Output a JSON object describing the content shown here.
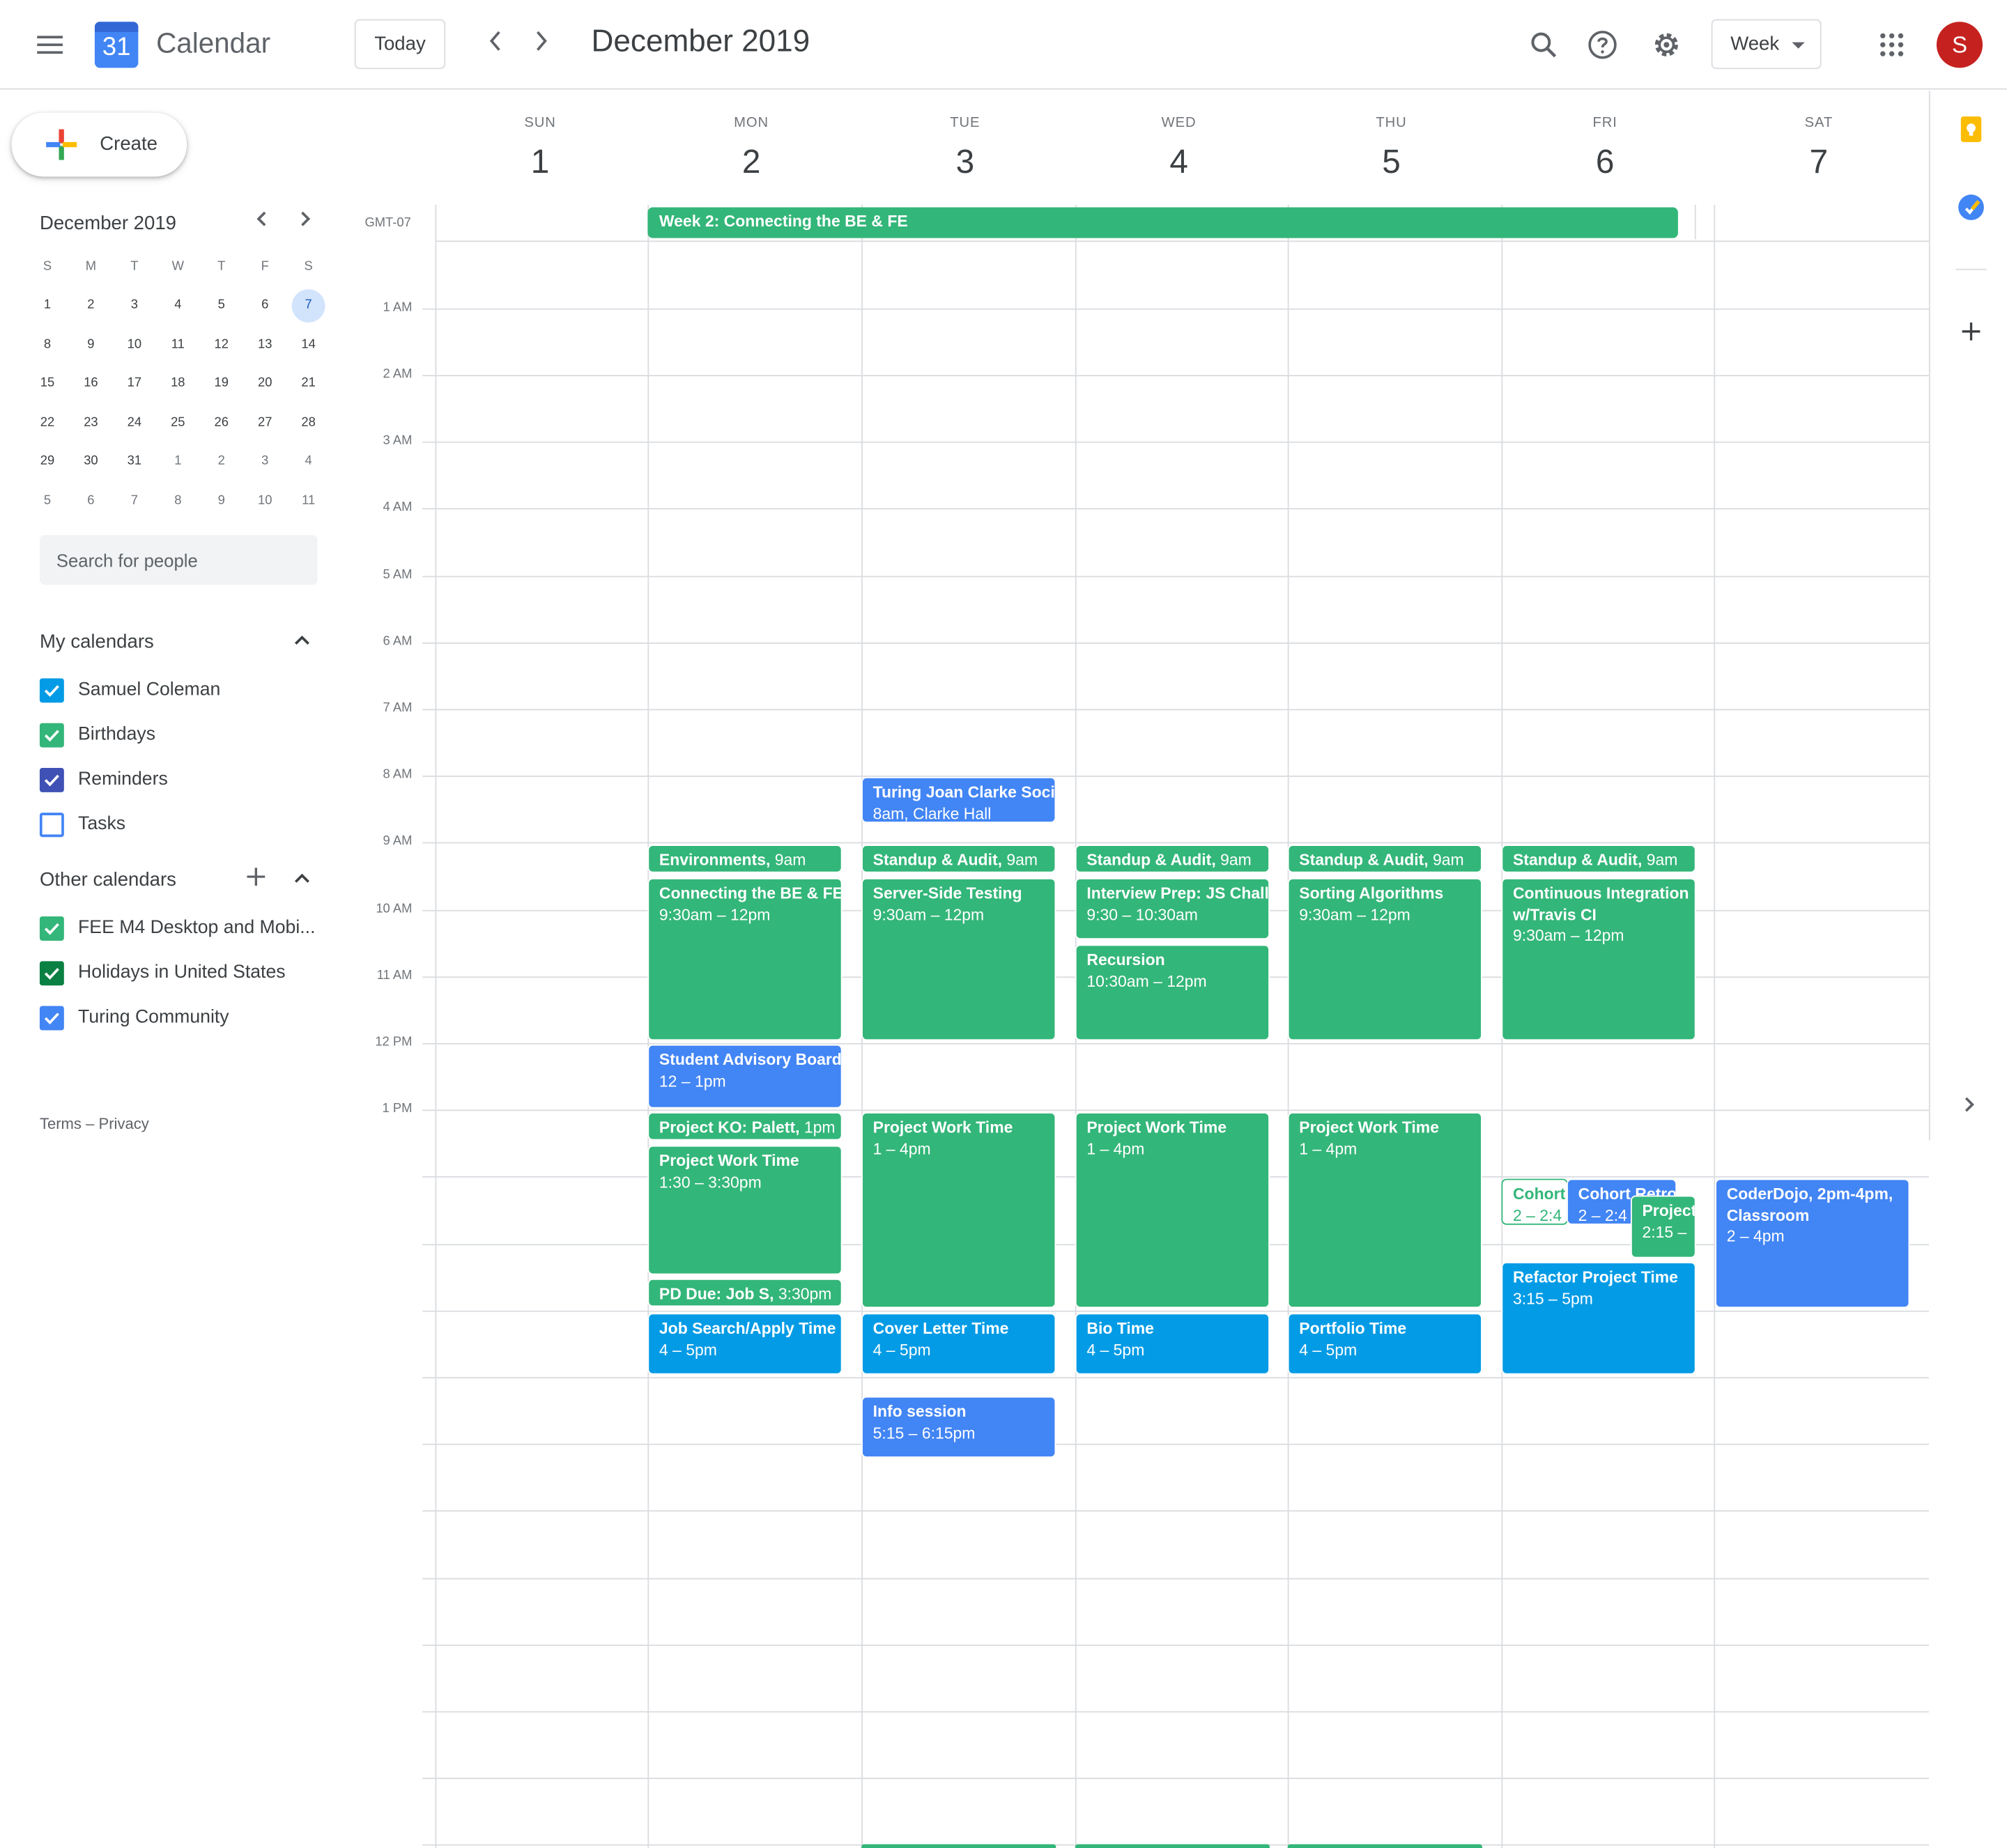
{
  "header": {
    "app_name": "Calendar",
    "logo_number": "31",
    "today_label": "Today",
    "period": "December 2019",
    "view": "Week",
    "avatar_letter": "S"
  },
  "sidebar": {
    "create_label": "Create",
    "mini_title": "December 2019",
    "weekday_initials": [
      "S",
      "M",
      "T",
      "W",
      "T",
      "F",
      "S"
    ],
    "mini_weeks": [
      [
        "1",
        "2",
        "3",
        "4",
        "5",
        "6",
        "7"
      ],
      [
        "8",
        "9",
        "10",
        "11",
        "12",
        "13",
        "14"
      ],
      [
        "15",
        "16",
        "17",
        "18",
        "19",
        "20",
        "21"
      ],
      [
        "22",
        "23",
        "24",
        "25",
        "26",
        "27",
        "28"
      ],
      [
        "29",
        "30",
        "31",
        "1",
        "2",
        "3",
        "4"
      ],
      [
        "5",
        "6",
        "7",
        "8",
        "9",
        "10",
        "11"
      ]
    ],
    "selected_day": "7",
    "search_placeholder": "Search for people",
    "my_calendars_title": "My calendars",
    "my_calendars": [
      {
        "name": "Samuel Coleman",
        "color": "#039be5",
        "checked": true
      },
      {
        "name": "Birthdays",
        "color": "#33b679",
        "checked": true
      },
      {
        "name": "Reminders",
        "color": "#3f51b5",
        "checked": true
      },
      {
        "name": "Tasks",
        "color": "#4285f4",
        "checked": false
      }
    ],
    "other_calendars_title": "Other calendars",
    "other_calendars": [
      {
        "name": "FEE M4 Desktop and Mobi...",
        "color": "#33b679",
        "checked": true
      },
      {
        "name": "Holidays in United States",
        "color": "#0b8043",
        "checked": true
      },
      {
        "name": "Turing Community",
        "color": "#4285f4",
        "checked": true
      }
    ],
    "terms": "Terms",
    "privacy": "Privacy",
    "terms_sep": "–"
  },
  "grid": {
    "timezone": "GMT-07",
    "days": [
      {
        "name": "SUN",
        "num": "1"
      },
      {
        "name": "MON",
        "num": "2"
      },
      {
        "name": "TUE",
        "num": "3"
      },
      {
        "name": "WED",
        "num": "4"
      },
      {
        "name": "THU",
        "num": "5"
      },
      {
        "name": "FRI",
        "num": "6"
      },
      {
        "name": "SAT",
        "num": "7"
      }
    ],
    "hours": [
      "1 AM",
      "2 AM",
      "3 AM",
      "4 AM",
      "5 AM",
      "6 AM",
      "7 AM",
      "8 AM",
      "9 AM",
      "10 AM",
      "11 AM",
      "12 PM",
      "1 PM"
    ],
    "allday_event": "Week 2: Connecting the BE & FE",
    "events": [
      {
        "id": "e1",
        "title": "Turing Joan Clarke Soci",
        "sub": "8am, Clarke Hall"
      },
      {
        "id": "e2",
        "title": "Environments,",
        "title_extra": " 9am"
      },
      {
        "id": "e3",
        "title": "Standup & Audit,",
        "title_extra": " 9am"
      },
      {
        "id": "e4",
        "title": "Standup & Audit,",
        "title_extra": " 9am"
      },
      {
        "id": "e5",
        "title": "Standup & Audit,",
        "title_extra": " 9am"
      },
      {
        "id": "e6",
        "title": "Standup & Audit,",
        "title_extra": " 9am"
      },
      {
        "id": "e7",
        "title": "Connecting the BE & FE",
        "sub": "9:30am – 12pm"
      },
      {
        "id": "e8",
        "title": "Server-Side Testing",
        "sub": "9:30am – 12pm"
      },
      {
        "id": "e9",
        "title": "Interview Prep: JS Challe",
        "sub": "9:30 – 10:30am"
      },
      {
        "id": "e10",
        "title": "Recursion",
        "sub": "10:30am – 12pm"
      },
      {
        "id": "e11",
        "title": "Sorting Algorithms",
        "sub": "9:30am – 12pm"
      },
      {
        "id": "e12",
        "title": "Continuous Integration",
        "title2": "w/Travis CI",
        "sub": "9:30am – 12pm"
      },
      {
        "id": "e13",
        "title": "Student Advisory Board",
        "sub": "12 – 1pm"
      },
      {
        "id": "e14",
        "title": "Project KO: Palett,",
        "title_extra": " 1pm"
      },
      {
        "id": "e15",
        "title": "Project Work Time",
        "sub": "1:30 – 3:30pm"
      },
      {
        "id": "e16",
        "title": "PD Due: Job S,",
        "title_extra": " 3:30pm"
      },
      {
        "id": "e17",
        "title": "Project Work Time",
        "sub": "1 – 4pm"
      },
      {
        "id": "e18",
        "title": "Project Work Time",
        "sub": "1 – 4pm"
      },
      {
        "id": "e19",
        "title": "Project Work Time",
        "sub": "1 – 4pm"
      },
      {
        "id": "e20",
        "title": "Cohort",
        "sub": "2 – 2:4"
      },
      {
        "id": "e21",
        "title": "Cohort Retro",
        "sub": "2 – 2:4"
      },
      {
        "id": "e22",
        "title": "Project",
        "sub": "2:15 –"
      },
      {
        "id": "e23",
        "title": "Refactor Project Time",
        "sub": "3:15 – 5pm"
      },
      {
        "id": "e24",
        "title": "CoderDojo, 2pm-4pm,",
        "title2": "Classroom",
        "sub": "2 – 4pm"
      },
      {
        "id": "e25",
        "title": "Job Search/Apply Time",
        "sub": "4 – 5pm"
      },
      {
        "id": "e26",
        "title": "Cover Letter Time",
        "sub": "4 – 5pm"
      },
      {
        "id": "e27",
        "title": "Bio Time",
        "sub": "4 – 5pm"
      },
      {
        "id": "e28",
        "title": "Portfolio Time",
        "sub": "4 – 5pm"
      },
      {
        "id": "e29",
        "title": "Info session",
        "sub": "5:15 – 6:15pm"
      }
    ]
  },
  "colors": {
    "green": "#33b679",
    "blue": "#039be5",
    "light_blue": "#4285f4",
    "avatar": "#c5221f"
  },
  "icons": [
    "menu-icon",
    "search-icon",
    "help-icon",
    "settings-icon",
    "apps-icon",
    "keep-icon",
    "tasks-icon",
    "add-icon",
    "expand-icon"
  ]
}
